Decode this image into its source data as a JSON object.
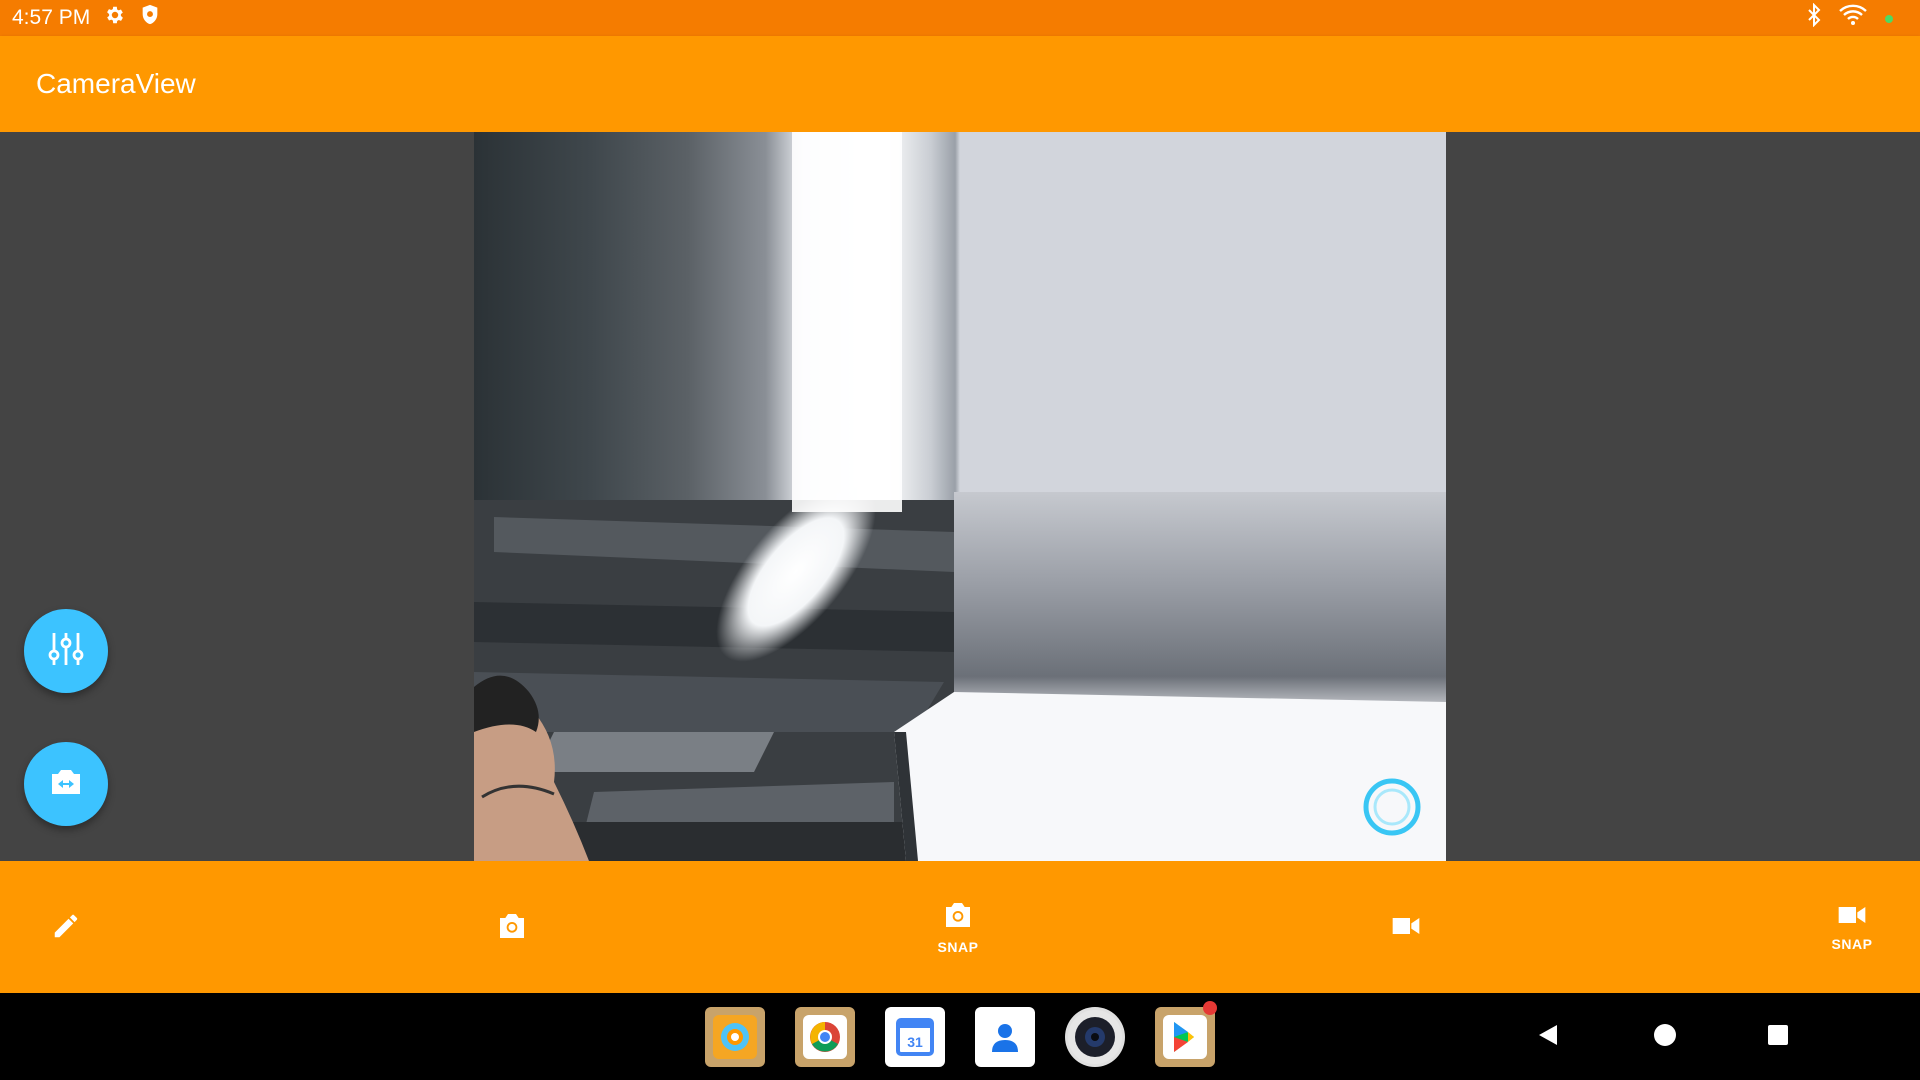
{
  "status_bar": {
    "time": "4:57 PM",
    "icons_left": [
      "gear-icon",
      "shield-icon"
    ],
    "icons_right": [
      "bluetooth-icon",
      "wifi-icon",
      "dot-indicator"
    ]
  },
  "app_bar": {
    "title": "CameraView"
  },
  "fabs": [
    {
      "icon": "tune-sliders-icon"
    },
    {
      "icon": "switch-camera-icon"
    }
  ],
  "bottom_bar": {
    "items": [
      {
        "icon": "pencil-icon",
        "label": ""
      },
      {
        "icon": "camera-icon",
        "label": ""
      },
      {
        "icon": "camera-icon",
        "label": "SNAP"
      },
      {
        "icon": "videocam-icon",
        "label": ""
      },
      {
        "icon": "videocam-icon",
        "label": "SNAP"
      }
    ]
  },
  "dock": {
    "apps": [
      "cameraview-app-icon",
      "chrome-icon",
      "calendar-icon",
      "contacts-icon",
      "camera-app-icon",
      "play-store-icon"
    ],
    "calendar_day": "31"
  },
  "colors": {
    "status_bar": "#F57C00",
    "app_bar": "#FF9800",
    "fab": "#3CC3FF",
    "background": "#444444"
  }
}
